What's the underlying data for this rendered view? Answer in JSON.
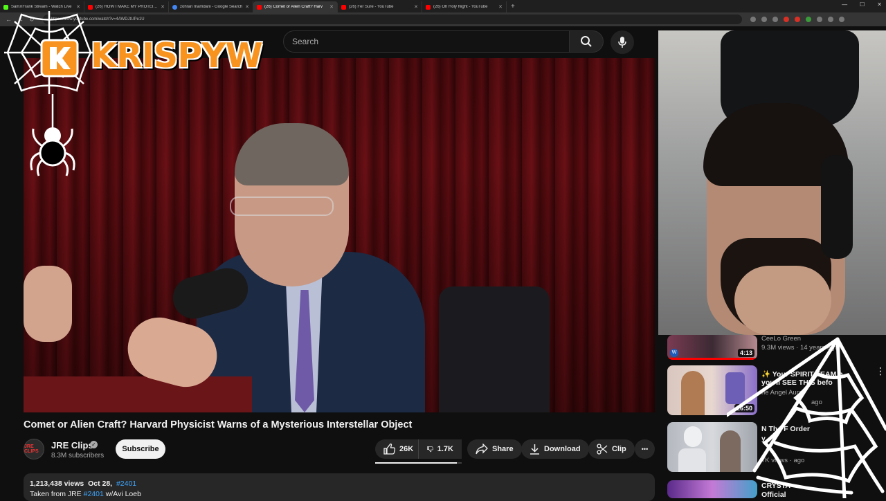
{
  "browser": {
    "tabs": [
      {
        "title": "SamXFrank Stream - Watch Live",
        "color": "#53fc18"
      },
      {
        "title": "(26) HOW I MAKE MY PROTEIN P",
        "color": "#ff0000"
      },
      {
        "title": "zohran mamdani - Google Search",
        "color": "#4285f4"
      },
      {
        "title": "(26) Comet or Alien Craft? Harv",
        "color": "#ff0000"
      },
      {
        "title": "(26) Fer Sure - YouTube",
        "color": "#ff0000"
      },
      {
        "title": "(26) Oh Holy Night - YouTube",
        "color": "#ff0000"
      }
    ],
    "new_tab": "+",
    "url": "https://www.youtube.com/watch?v=4AWDJtUPe1U",
    "back": "←",
    "forward": "→",
    "reload": "↻",
    "minimize": "—",
    "maximize": "☐",
    "close": "✕"
  },
  "overlay": {
    "logo_text": "KRISPYW"
  },
  "header": {
    "search_placeholder": "Search"
  },
  "video": {
    "title": "Comet or Alien Craft? Harvard Physicist Warns of a Mysterious Interstellar Object"
  },
  "channel": {
    "name": "JRE Clips",
    "subscribers": "8.3M subscribers",
    "avatar_text": "JRE CLIPS",
    "subscribe_label": "Subscribe"
  },
  "actions": {
    "likes": "26K",
    "dislikes": "1.7K",
    "share": "Share",
    "download": "Download",
    "clip": "Clip",
    "more": "•••",
    "like_ratio": 0.94
  },
  "description": {
    "views": "1,213,438 views",
    "date": "Oct 28,",
    "tag": "#2401",
    "line2_prefix": "Taken from JRE",
    "line2_link": "#2401",
    "line2_suffix": "w/Avi Loeb"
  },
  "sidebar": {
    "items": [
      {
        "title": "CeeLo Green",
        "meta": "9.3M views · 14 years ago",
        "duration": "4:13"
      },
      {
        "title": "✨ Your SPIRIT TEAM h",
        "title2": "you'll SEE THIS befo",
        "channel": "he Angel Aura",
        "meta": "ago",
        "duration": "26:50"
      },
      {
        "title": "N The F Order",
        "title2": "y",
        "meta": "7K views · ago",
        "duration": ""
      },
      {
        "title": "CRYSTA",
        "title2": "Official",
        "meta": "",
        "duration": ""
      }
    ]
  },
  "colors": {
    "accent": "#f7931e",
    "background": "#0f0f0f",
    "link": "#3ea6ff"
  }
}
